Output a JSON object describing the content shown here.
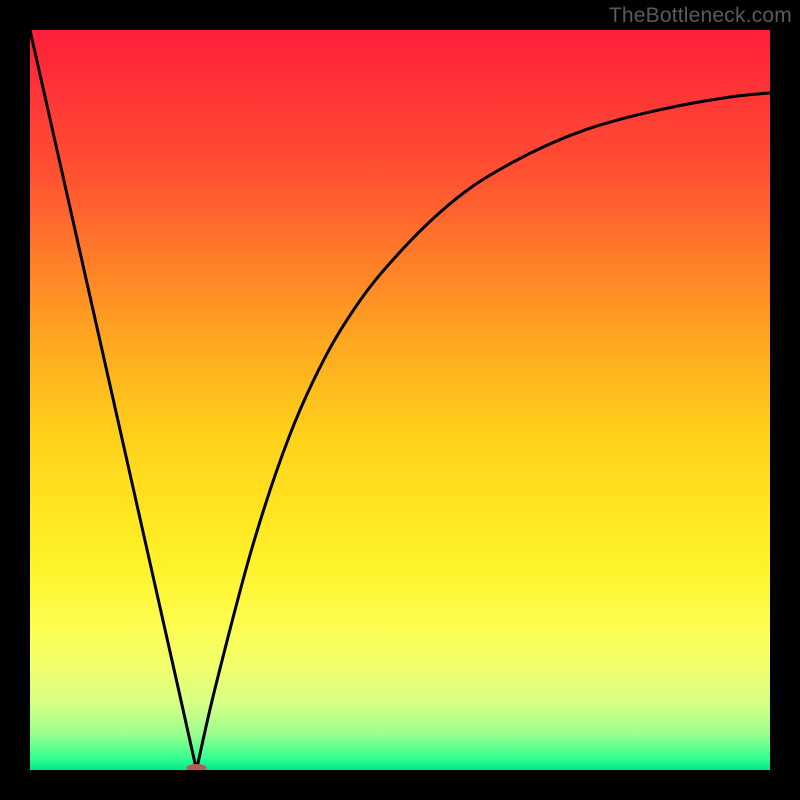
{
  "watermark": "TheBottleneck.com",
  "chart_data": {
    "type": "line",
    "title": "",
    "xlabel": "",
    "ylabel": "",
    "xlim": [
      0,
      100
    ],
    "ylim": [
      0,
      100
    ],
    "grid": false,
    "x": [
      0,
      5,
      10,
      15,
      20,
      22.5,
      25,
      30,
      35,
      40,
      45,
      50,
      55,
      60,
      65,
      70,
      75,
      80,
      85,
      90,
      95,
      100
    ],
    "values": [
      100,
      77.8,
      55.6,
      33.4,
      11.2,
      0,
      11,
      30,
      45,
      56,
      64,
      70,
      75,
      79,
      82,
      84.5,
      86.5,
      88,
      89.2,
      90.2,
      91,
      91.5
    ],
    "minimum_x": 22.5,
    "marker": {
      "x": 22.5,
      "y": 0,
      "rx": 10,
      "ry": 4,
      "color": "#bb5a55"
    },
    "background_gradient": {
      "stops": [
        {
          "offset": 0.0,
          "color": "#ff1f3a"
        },
        {
          "offset": 0.2,
          "color": "#ff5331"
        },
        {
          "offset": 0.4,
          "color": "#ffa022"
        },
        {
          "offset": 0.55,
          "color": "#ffd21a"
        },
        {
          "offset": 0.72,
          "color": "#fff228"
        },
        {
          "offset": 0.8,
          "color": "#fdfd4e"
        },
        {
          "offset": 0.86,
          "color": "#f2fe6c"
        },
        {
          "offset": 0.91,
          "color": "#d6ff86"
        },
        {
          "offset": 0.95,
          "color": "#9dff8c"
        },
        {
          "offset": 0.985,
          "color": "#32ff91"
        },
        {
          "offset": 1.0,
          "color": "#00e58c"
        }
      ]
    },
    "curve_color": "#000000",
    "curve_width": 3
  }
}
